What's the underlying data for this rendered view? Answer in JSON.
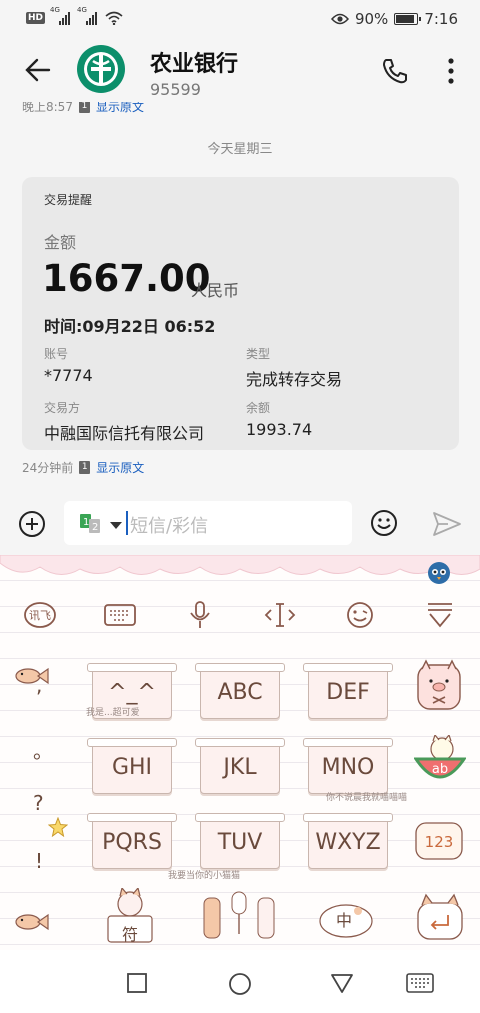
{
  "status_bar": {
    "hd": "HD",
    "network1": "4G",
    "network2": "4G",
    "battery": "90%",
    "battery_level": 0.9,
    "time": "7:16"
  },
  "header": {
    "title": "农业银行",
    "number": "95599"
  },
  "messages": {
    "previous_meta": {
      "time": "晚上8:57",
      "sim": "1",
      "link": "显示原文"
    },
    "date_separator": "今天星期三",
    "card": {
      "title": "交易提醒",
      "amount_label": "金额",
      "amount": "1667.00",
      "currency": "人民币",
      "time_line": "时间:09月22日 06:52",
      "fields": [
        {
          "label": "账号",
          "value": "*7774"
        },
        {
          "label": "类型",
          "value": "完成转存交易"
        },
        {
          "label": "交易方",
          "value": "中融国际信托有限公司"
        },
        {
          "label": "余额",
          "value": "1993.74"
        }
      ]
    },
    "card_meta": {
      "time": "24分钟前",
      "sim": "1",
      "link": "显示原文"
    }
  },
  "composer": {
    "placeholder": "短信/彩信",
    "sim_badge": "1 2"
  },
  "keyboard": {
    "toolbar": [
      "xunfei-icon",
      "keyboard-icon",
      "microphone-icon",
      "cursor-move-icon",
      "emoji-icon",
      "hide-keyboard-icon"
    ],
    "toolbar_xunfei_label": "讯飞",
    "side_symbols": [
      ",",
      "。",
      "?",
      "!"
    ],
    "keys": [
      "^_^",
      "ABC",
      "DEF",
      "GHI",
      "JKL",
      "MNO",
      "PQRS",
      "TUV",
      "WXYZ"
    ],
    "bottom_symbol_key": "符",
    "bottom_space_char": "中",
    "number_key": "123",
    "melon_key": "ab",
    "decor_texts": [
      "我要当你的小猫猫",
      "你不说晨我就喵喵喵",
      "我是...超可爱"
    ]
  },
  "colors": {
    "bank_green": "#0c8f6b",
    "link_blue": "#1a5fbf",
    "key_text": "#6a4a3c",
    "key_fill": "#fdf1ef"
  }
}
